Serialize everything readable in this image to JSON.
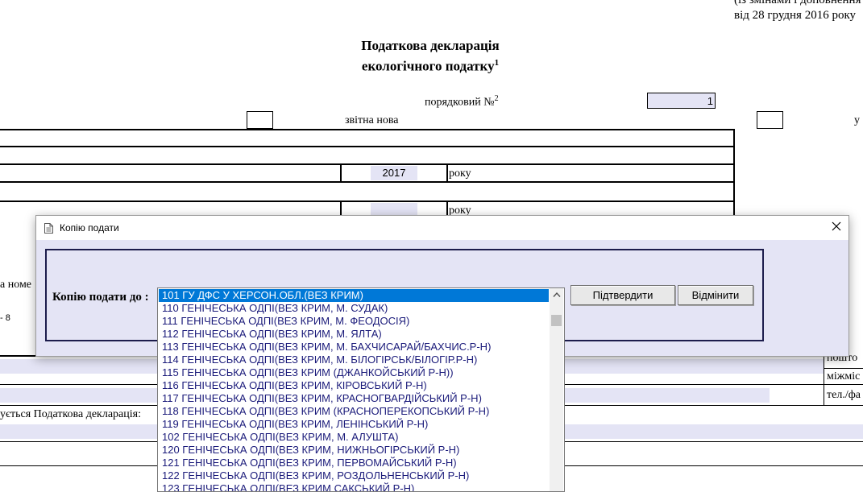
{
  "header": {
    "note_line1": "(із змінами і доповнення",
    "note_line2": "від 28 грудня 2016 року",
    "title_line1": "Податкова декларація",
    "title_line2": "екологічного податку",
    "title_sup": "1",
    "order_label": "порядковий №",
    "order_sup": "2",
    "order_value": "1",
    "type_label": "звітна нова",
    "right_cut": "у"
  },
  "form": {
    "year_value": "2017",
    "year_unit": "року",
    "year_unit2": "року",
    "name_cut": "а номе",
    "small_cut": "- 8",
    "postal_cut": "пошто",
    "intercity_cut": "міжміс",
    "phone_cut": "тел./фа",
    "declaration_cut": "ується Податкова декларація:"
  },
  "dialog": {
    "title": "Копію подати",
    "label": "Копію подати до :",
    "confirm_label": "Підтвердити",
    "cancel_label": "Відмінити",
    "close_icon": "close-icon"
  },
  "dropdown": {
    "items": [
      "101 ГУ ДФС У ХЕРСОН.ОБЛ.(ВЕЗ КРИМ)",
      "110 ГЕНІЧЕСЬКА ОДПІ(ВЕЗ КРИМ, М. СУДАК)",
      "111 ГЕНІЧЕСЬКА ОДПІ(ВЕЗ КРИМ, М. ФЕОДОСІЯ)",
      "112 ГЕНІЧЕСЬКА ОДПІ(ВЕЗ КРИМ, М. ЯЛТА)",
      "113 ГЕНІЧЕСЬКА ОДПІ(ВЕЗ КРИМ, М. БАХЧИСАРАЙ/БАХЧИС.Р-Н)",
      "114 ГЕНІЧЕСЬКА ОДПІ(ВЕЗ КРИМ, М. БІЛОГІРСЬК/БІЛОГІР.Р-Н)",
      "115 ГЕНІЧЕСЬКА ОДПІ(ВЕЗ КРИМ (ДЖАНКОЙСЬКИЙ Р-Н))",
      "116 ГЕНІЧЕСЬКА ОДПІ(ВЕЗ КРИМ, КІРОВСЬКИЙ Р-Н)",
      "117 ГЕНІЧЕСЬКА ОДПІ(ВЕЗ КРИМ, КРАСНОГВАРДІЙСЬКИЙ Р-Н)",
      "118 ГЕНІЧЕСЬКА ОДПІ(ВЕЗ КРИМ (КРАСНОПЕРЕКОПСЬКИЙ Р-Н)",
      "119 ГЕНІЧЕСЬКА ОДПІ(ВЕЗ КРИМ, ЛЕНІНСЬКИЙ Р-Н)",
      "102 ГЕНІЧЕСЬКА ОДПІ(ВЕЗ КРИМ, М. АЛУШТА)",
      "120 ГЕНІЧЕСЬКА ОДПІ(ВЕЗ КРИМ, НИЖНЬОГІРСЬКИЙ Р-Н)",
      "121 ГЕНІЧЕСЬКА ОДПІ(ВЕЗ КРИМ, ПЕРВОМАЙСЬКИЙ Р-Н)",
      "122 ГЕНІЧЕСЬКА ОДПІ(ВЕЗ КРИМ, РОЗДОЛЬНЕНСЬКИЙ Р-Н)",
      "123 ГЕНІЧЕСЬКА ОДПІ(ВЕЗ КРИМ САКСЬКИЙ Р-Н)"
    ],
    "selected_index": 0
  },
  "colors": {
    "shade": "#e4e4f5",
    "selection": "#0078d7",
    "list_text": "#1a1a7a"
  }
}
